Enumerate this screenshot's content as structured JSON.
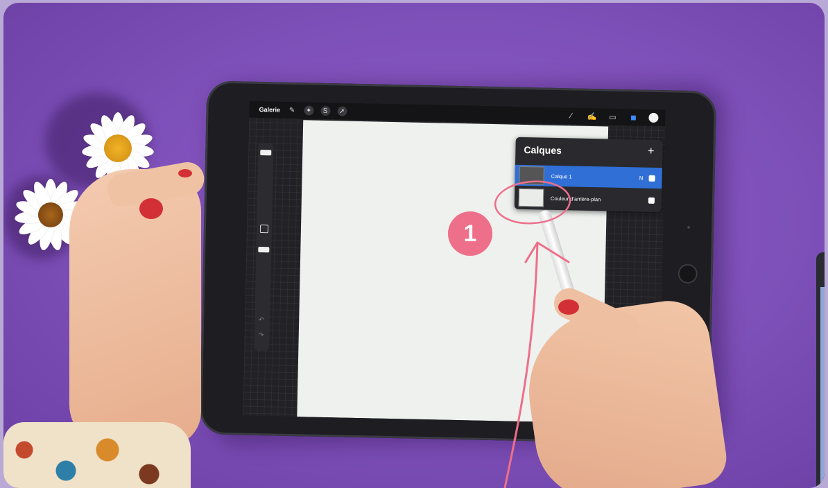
{
  "app": {
    "gallery_label": "Galerie",
    "layers_panel": {
      "title": "Calques",
      "add_symbol": "+",
      "layers": [
        {
          "name": "Calque 1",
          "tag": "N",
          "selected": true
        },
        {
          "name": "Couleur d'arrière-plan",
          "selected": false
        }
      ]
    }
  },
  "annotation": {
    "step_number": "1",
    "accent_color": "#ee6f8a",
    "highlight_color": "#3b8cff"
  }
}
